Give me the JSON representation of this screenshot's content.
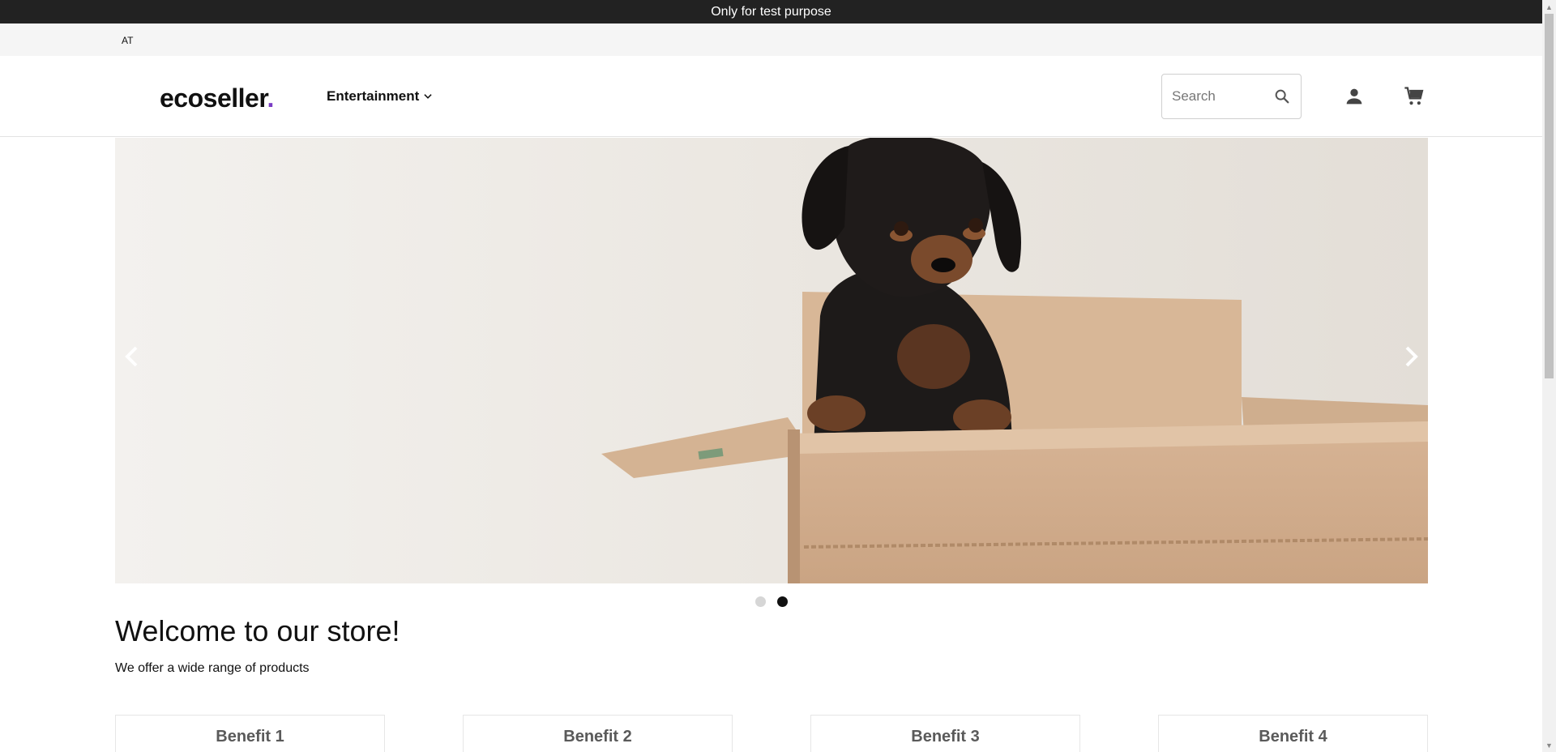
{
  "announcement": "Only for test purpose",
  "locale": "AT",
  "header": {
    "logo_text": "ecoseller",
    "logo_dot": ".",
    "nav_item": "Entertainment",
    "search_placeholder": "Search"
  },
  "hero": {
    "slides_count": 2,
    "active_slide": 2
  },
  "welcome": {
    "title": "Welcome to our store!",
    "subtitle": "We offer a wide range of products"
  },
  "benefits": [
    {
      "label": "Benefit 1"
    },
    {
      "label": "Benefit 2"
    },
    {
      "label": "Benefit 3"
    },
    {
      "label": "Benefit 4"
    }
  ],
  "colors": {
    "accent": "#7a3cc4",
    "announcement_bg": "#222222"
  },
  "icons": [
    "chevron-down-icon",
    "search-icon",
    "user-icon",
    "cart-icon",
    "chevron-left-icon",
    "chevron-right-icon"
  ]
}
